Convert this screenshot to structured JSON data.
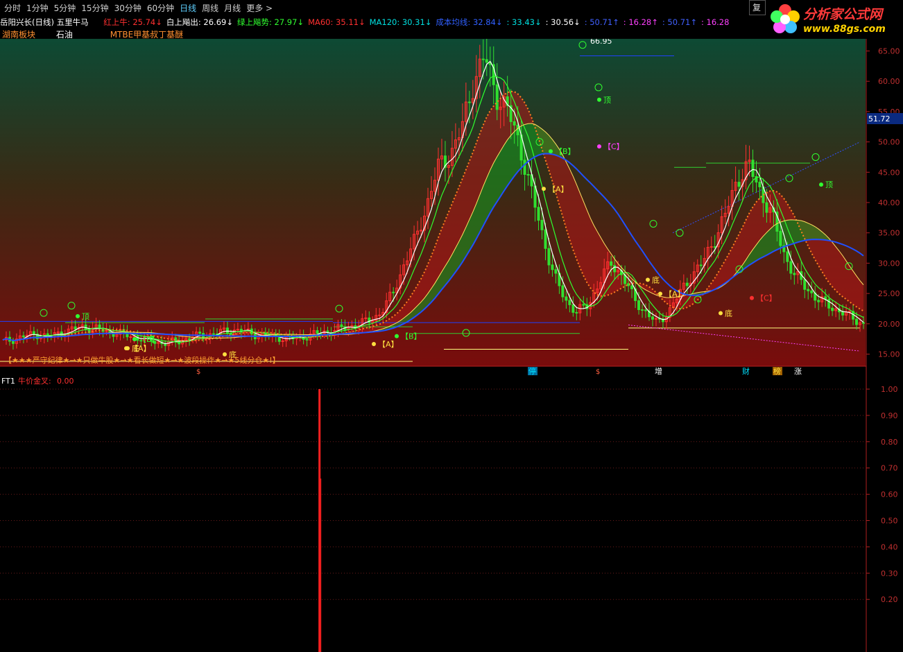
{
  "toolbar": {
    "periods": [
      "分时",
      "1分钟",
      "5分钟",
      "15分钟",
      "30分钟",
      "60分钟",
      "日线",
      "周线",
      "月线",
      "更多 >"
    ],
    "active": "日线",
    "restore_label": "复"
  },
  "logo": {
    "name": "分析家公式网",
    "url": "www.88gs.com"
  },
  "header": {
    "title": "岳阳兴长(日线) 五里牛马",
    "indicators": [
      {
        "label": "红上牛:",
        "value": "25.74",
        "arrow": "↓",
        "color": "#ff3030"
      },
      {
        "label": "白上飚出:",
        "value": "26.69",
        "arrow": "↓",
        "color": "#ffffff"
      },
      {
        "label": "绿上飚势:",
        "value": "27.97",
        "arrow": "↓",
        "color": "#30ff30"
      },
      {
        "label": "MA60:",
        "value": "35.11",
        "arrow": "↓",
        "color": "#ff3030"
      },
      {
        "label": "MA120:",
        "value": "30.31",
        "arrow": "↓",
        "color": "#00e0e0"
      },
      {
        "label": "成本均线:",
        "value": "32.84",
        "arrow": "↓",
        "color": "#3060ff"
      },
      {
        "label": "",
        "value": "33.43",
        "arrow": "↓",
        "color": "#00e0e0"
      },
      {
        "label": "",
        "value": "30.56",
        "arrow": "↓",
        "color": "#ffffff"
      },
      {
        "label": "",
        "value": "50.71",
        "arrow": "↑",
        "color": "#4060ff"
      },
      {
        "label": "",
        "value": "16.28",
        "arrow": "↑",
        "color": "#ff40ff"
      },
      {
        "label": "",
        "value": "50.71",
        "arrow": "↑",
        "color": "#4060ff"
      },
      {
        "label": "",
        "value": "16.28",
        "arrow": "",
        "color": "#ff40ff"
      }
    ],
    "sector": "湖南板块",
    "concept": "石油",
    "tag": "MTBE甲基叔丁基醚"
  },
  "main_axis": {
    "ticks": [
      "65.00",
      "60.00",
      "55.00",
      "50.00",
      "45.00",
      "40.00",
      "35.00",
      "30.00",
      "25.00",
      "20.00",
      "15.00"
    ],
    "current_price": "51.72",
    "peak_label": "66.95"
  },
  "chart_annotations": {
    "slogan": "【★★★严守纪律★→★只做牛股★→★看长做短★→★波段操作★→★5线分仓★!】",
    "bottom_events": [
      "停",
      "增",
      "财",
      "榜",
      "涨"
    ],
    "dollar": "$",
    "top_label": "顶",
    "bottom_label": "底",
    "a_label": "【A】",
    "b_label": "【B】",
    "c_label": "【C】"
  },
  "sub": {
    "name": "FT1",
    "indicator_label": "牛价金叉:",
    "indicator_value": "0.00",
    "ticks": [
      "1.00",
      "0.90",
      "0.80",
      "0.70",
      "0.60",
      "0.50",
      "0.40",
      "0.30",
      "0.20"
    ]
  },
  "chart_data": {
    "type": "candlestick_with_indicators",
    "price_range": [
      13,
      67
    ],
    "approx_close_path": [
      17,
      17.5,
      18,
      18.3,
      17.8,
      18.5,
      19,
      19.5,
      19.2,
      18.8,
      18.5,
      18,
      17.6,
      17.2,
      16.8,
      17,
      17.5,
      18,
      18.2,
      18.6,
      19,
      18.7,
      18.3,
      18,
      17.8,
      17.5,
      17.8,
      18.2,
      18.6,
      19,
      19.4,
      20,
      20.5,
      22,
      25,
      30,
      34,
      40,
      46,
      48,
      52,
      60,
      64,
      58,
      55,
      50,
      42,
      35,
      28,
      24,
      22,
      23,
      27,
      30,
      28,
      24,
      22,
      20,
      22,
      25,
      28,
      30,
      34,
      38,
      44,
      46,
      42,
      38,
      32,
      28,
      26,
      24,
      23,
      22,
      21,
      20
    ],
    "sub_signal_at_fraction": 0.368,
    "sub_signal_value": 1.0
  }
}
